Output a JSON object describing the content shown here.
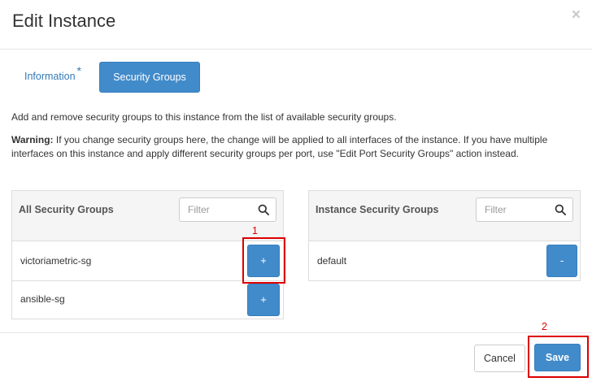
{
  "modal": {
    "title": "Edit Instance",
    "close_glyph": "×"
  },
  "tabs": {
    "information": {
      "label": "Information",
      "required_mark": "*"
    },
    "security_groups": {
      "label": "Security Groups"
    }
  },
  "content": {
    "intro": "Add and remove security groups to this instance from the list of available security groups.",
    "warning_label": "Warning:",
    "warning_text": " If you change security groups here, the change will be applied to all interfaces of the instance. If you have multiple interfaces on this instance and apply different security groups per port, use \"Edit Port Security Groups\" action instead."
  },
  "all_groups": {
    "title": "All Security Groups",
    "filter_placeholder": "Filter",
    "items": [
      {
        "name": "victoriametric-sg",
        "action": "+"
      },
      {
        "name": "ansible-sg",
        "action": "+"
      }
    ]
  },
  "instance_groups": {
    "title": "Instance Security Groups",
    "filter_placeholder": "Filter",
    "items": [
      {
        "name": "default",
        "action": "-"
      }
    ]
  },
  "annotations": [
    {
      "number": "1"
    },
    {
      "number": "2"
    }
  ],
  "footer": {
    "cancel_label": "Cancel",
    "save_label": "Save"
  },
  "colors": {
    "primary": "#428bca",
    "annotation": "#dd0000"
  },
  "icons": {
    "close": "close-icon",
    "search": "search-icon"
  }
}
